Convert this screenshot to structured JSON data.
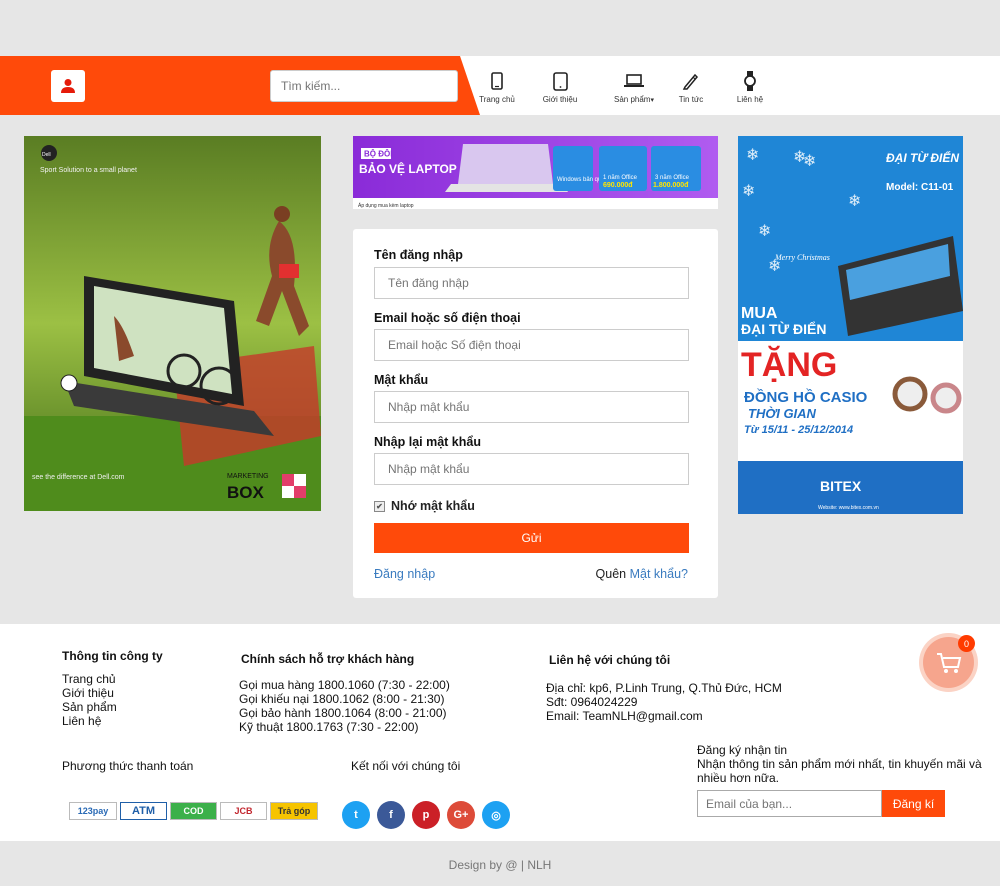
{
  "header": {
    "search_placeholder": "Tìm kiếm...",
    "nav": [
      {
        "label": "Trang chủ",
        "icon": "phone-icon"
      },
      {
        "label": "Giới thiệu",
        "icon": "tablet-icon"
      },
      {
        "label": "Sản phẩm",
        "icon": "laptop-icon"
      },
      {
        "label": "Tin tức",
        "icon": "pen-icon"
      },
      {
        "label": "Liên hệ",
        "icon": "watch-icon"
      }
    ],
    "accent": "#ff4a0a"
  },
  "ads": {
    "left": {
      "tagline": "Sport Solution to a small planet",
      "footer": "see the difference at Dell.com",
      "brand": "Dell",
      "stamp_1": "MARKETING",
      "stamp_2": "BOX"
    },
    "top": {
      "line1": "BỘ ĐÔI",
      "line2": "BẢO VỆ LAPTOP",
      "win": "Windows bản quyền",
      "o1": "1 năm Office",
      "p1": "690.000đ",
      "o2": "3 năm Office",
      "p2": "1.800.000đ",
      "note": "Áp dụng mua kèm laptop"
    },
    "right": {
      "brand": "ĐẠI TỪ ĐIỂN",
      "model": "Model: C11-01",
      "xmas": "Merry Christmas",
      "mua": "MUA",
      "dtd": "ĐẠI TỪ ĐIỂN",
      "tang": "TẶNG",
      "casio": "ĐỒNG HỒ CASIO",
      "thoigian": "THỜI GIAN",
      "dates": "Từ 15/11 - 25/12/2014",
      "bitex": "BITEX",
      "site": "Website: www.bitex.com.vn"
    }
  },
  "form": {
    "username_label": "Tên đăng nhập",
    "username_placeholder": "Tên đăng nhập",
    "contact_label": "Email hoặc số điện thoại",
    "contact_placeholder": "Email hoặc Số điện thoại",
    "password_label": "Mật khẩu",
    "password_placeholder": "Nhập mật khẩu",
    "confirm_label": "Nhập lại mật khẩu",
    "confirm_placeholder": "Nhập mật khẩu",
    "remember_label": "Nhớ mật khẩu",
    "submit_label": "Gửi",
    "login_link": "Đăng nhập",
    "forgot_prefix": "Quên",
    "forgot_link": "Mật khẩu?"
  },
  "footer": {
    "company_title": "Thông tin công ty",
    "company_links": [
      "Trang chủ",
      "Giới thiệu",
      "Sản phẩm",
      "Liên hệ"
    ],
    "policy_title": "Chính sách hỗ trợ khách hàng",
    "policy_lines": [
      "Gọi mua hàng 1800.1060 (7:30 - 22:00)",
      "Gọi khiếu nại 1800.1062 (8:00 - 21:30)",
      "Gọi bảo hành 1800.1064 (8:00 - 21:00)",
      "Kỹ thuật 1800.1763 (7:30 - 22:00)"
    ],
    "contact_title": "Liên hệ với chúng tôi",
    "contact_lines": [
      "Địa chỉ: kp6, P.Linh Trung, Q.Thủ Đức, HCM",
      "Sđt: 0964024229",
      "Email: TeamNLH@gmail.com"
    ],
    "payment_title": "Phương thức thanh toán",
    "payments": [
      "123pay",
      "ATM",
      "COD",
      "JCB",
      "Trả góp"
    ],
    "social_title": "Kết nối với chúng tôi",
    "socials": [
      {
        "icon": "twitter-icon",
        "glyph": "t",
        "color": "#1da1f2"
      },
      {
        "icon": "facebook-icon",
        "glyph": "f",
        "color": "#3b5998"
      },
      {
        "icon": "pinterest-icon",
        "glyph": "p",
        "color": "#cb2027"
      },
      {
        "icon": "google-plus-icon",
        "glyph": "G+",
        "color": "#dd4b39"
      },
      {
        "icon": "instagram-icon",
        "glyph": "◎",
        "color": "#1da1f2"
      }
    ],
    "newsletter_title": "Đăng ký nhận tin",
    "newsletter_desc": "Nhận thông tin sản phẩm mới nhất, tin khuyến mãi và nhiều hơn nữa.",
    "email_placeholder": "Email của bạn...",
    "register_label": "Đăng kí"
  },
  "cart": {
    "count": "0"
  },
  "copyright": "Design by @ | NLH"
}
